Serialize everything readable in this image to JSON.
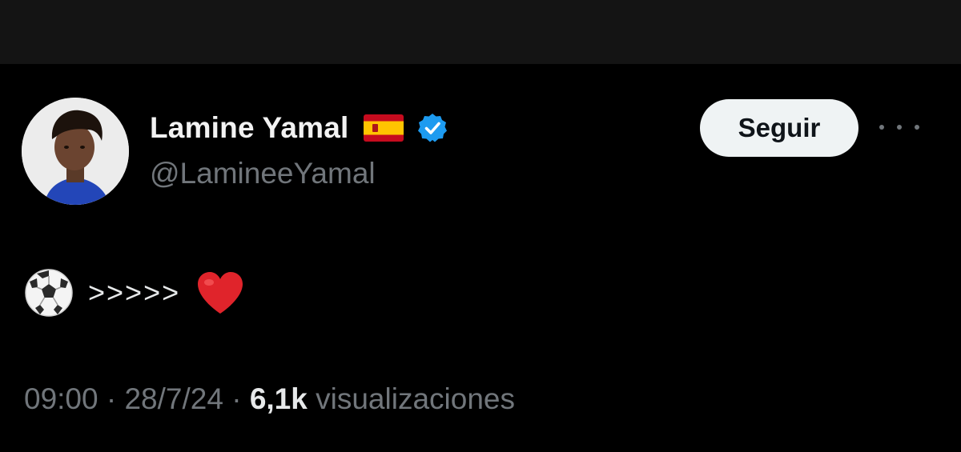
{
  "header": {},
  "tweet": {
    "author": {
      "display_name": "Lamine Yamal",
      "handle": "@LamineeYamal",
      "flag_icon": "spain-flag-icon",
      "verified_icon": "verified-badge-icon"
    },
    "follow_label": "Seguir",
    "more_icon": "more-options-icon",
    "body": {
      "leading_icon": "soccer-ball-icon",
      "text": ">>>>>",
      "trailing_icon": "red-heart-icon"
    },
    "meta": {
      "time": "09:00",
      "separator": "·",
      "date": "28/7/24",
      "views_count": "6,1k",
      "views_label": "visualizaciones"
    }
  },
  "colors": {
    "background": "#000000",
    "top_bar": "#141414",
    "primary_text": "#e7e9ea",
    "secondary_text": "#71767b",
    "verified_blue": "#1d9bf0",
    "follow_button_bg": "#eff3f4",
    "heart_red": "#e0242b"
  }
}
